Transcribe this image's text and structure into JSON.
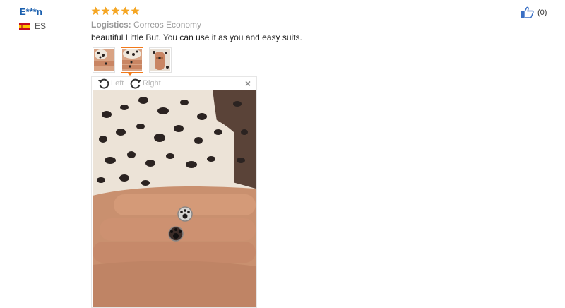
{
  "review": {
    "user": "E***n",
    "country": "ES",
    "rating": 5,
    "logistics_label": "Logistics:",
    "logistics_value": "Correos Economy",
    "text": "beautiful Little But. You can use it as you and easy suits.",
    "helpful_count": "(0)"
  },
  "viewer": {
    "rotate_left": "Left",
    "rotate_right": "Right",
    "close": "×"
  },
  "icons": {
    "star": "star-icon",
    "flag": "flag-es-icon",
    "helpful": "thumbs-up-icon",
    "rotate_left": "rotate-left-icon",
    "rotate_right": "rotate-right-icon",
    "close": "close-icon"
  },
  "colors": {
    "star": "#f5a623",
    "username": "#1a5fae",
    "active_border": "#f27a1a",
    "helpful_icon": "#3a6fc4"
  }
}
